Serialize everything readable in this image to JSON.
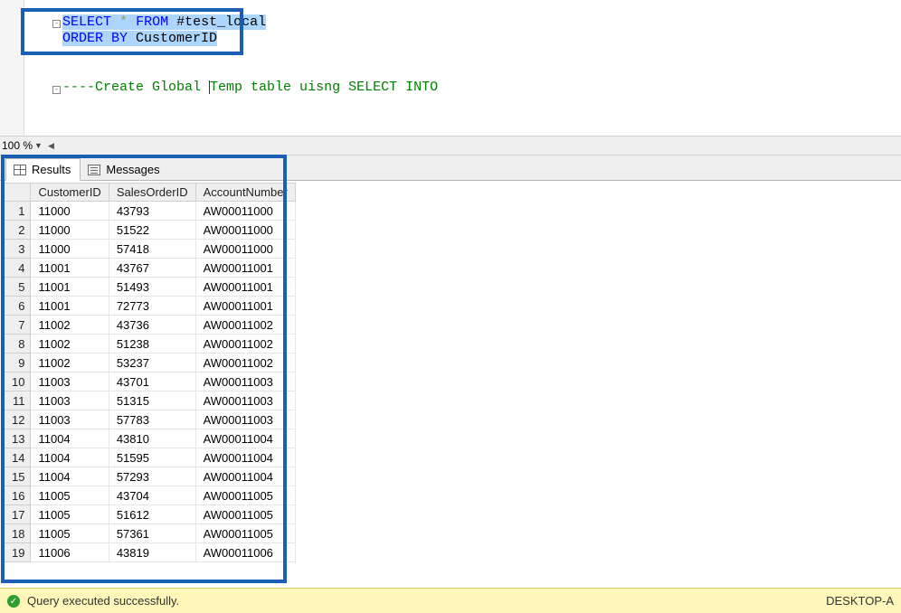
{
  "editor": {
    "line1": {
      "kw1": "SELECT",
      "star": "*",
      "kw2": "FROM",
      "tbl": "#test_local"
    },
    "line2": {
      "kw": "ORDER BY",
      "col": "CustomerID"
    },
    "comment_prefix": "----Create Global ",
    "comment_t": "T",
    "comment_rest": "emp table uisng SELECT INTO",
    "fold": "-"
  },
  "zoom": {
    "value": "100 %"
  },
  "tabs": {
    "results": "Results",
    "messages": "Messages"
  },
  "grid": {
    "columns": [
      "CustomerID",
      "SalesOrderID",
      "AccountNumber"
    ],
    "rows": [
      {
        "n": "1",
        "CustomerID": "11000",
        "SalesOrderID": "43793",
        "AccountNumber": "AW00011000"
      },
      {
        "n": "2",
        "CustomerID": "11000",
        "SalesOrderID": "51522",
        "AccountNumber": "AW00011000"
      },
      {
        "n": "3",
        "CustomerID": "11000",
        "SalesOrderID": "57418",
        "AccountNumber": "AW00011000"
      },
      {
        "n": "4",
        "CustomerID": "11001",
        "SalesOrderID": "43767",
        "AccountNumber": "AW00011001"
      },
      {
        "n": "5",
        "CustomerID": "11001",
        "SalesOrderID": "51493",
        "AccountNumber": "AW00011001"
      },
      {
        "n": "6",
        "CustomerID": "11001",
        "SalesOrderID": "72773",
        "AccountNumber": "AW00011001"
      },
      {
        "n": "7",
        "CustomerID": "11002",
        "SalesOrderID": "43736",
        "AccountNumber": "AW00011002"
      },
      {
        "n": "8",
        "CustomerID": "11002",
        "SalesOrderID": "51238",
        "AccountNumber": "AW00011002"
      },
      {
        "n": "9",
        "CustomerID": "11002",
        "SalesOrderID": "53237",
        "AccountNumber": "AW00011002"
      },
      {
        "n": "10",
        "CustomerID": "11003",
        "SalesOrderID": "43701",
        "AccountNumber": "AW00011003"
      },
      {
        "n": "11",
        "CustomerID": "11003",
        "SalesOrderID": "51315",
        "AccountNumber": "AW00011003"
      },
      {
        "n": "12",
        "CustomerID": "11003",
        "SalesOrderID": "57783",
        "AccountNumber": "AW00011003"
      },
      {
        "n": "13",
        "CustomerID": "11004",
        "SalesOrderID": "43810",
        "AccountNumber": "AW00011004"
      },
      {
        "n": "14",
        "CustomerID": "11004",
        "SalesOrderID": "51595",
        "AccountNumber": "AW00011004"
      },
      {
        "n": "15",
        "CustomerID": "11004",
        "SalesOrderID": "57293",
        "AccountNumber": "AW00011004"
      },
      {
        "n": "16",
        "CustomerID": "11005",
        "SalesOrderID": "43704",
        "AccountNumber": "AW00011005"
      },
      {
        "n": "17",
        "CustomerID": "11005",
        "SalesOrderID": "51612",
        "AccountNumber": "AW00011005"
      },
      {
        "n": "18",
        "CustomerID": "11005",
        "SalesOrderID": "57361",
        "AccountNumber": "AW00011005"
      },
      {
        "n": "19",
        "CustomerID": "11006",
        "SalesOrderID": "43819",
        "AccountNumber": "AW00011006"
      }
    ]
  },
  "status": {
    "text": "Query executed successfully.",
    "server": "DESKTOP-A"
  }
}
